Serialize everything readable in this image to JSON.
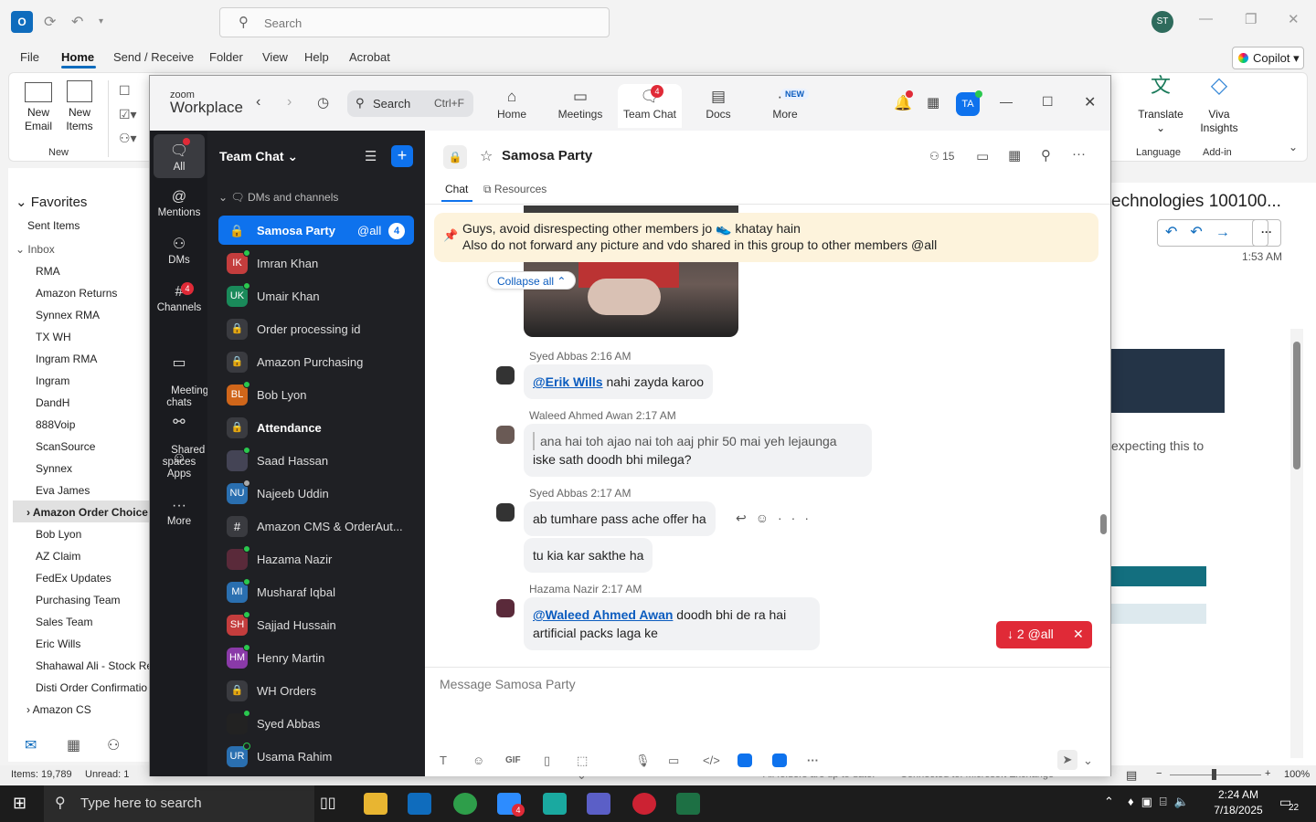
{
  "outlook": {
    "search_placeholder": "Search",
    "avatar": "ST",
    "menu": [
      "File",
      "Home",
      "Send / Receive",
      "Folder",
      "View",
      "Help",
      "Acrobat"
    ],
    "copilot": "Copilot",
    "ribbon": {
      "new_email": "New\nEmail",
      "new_items": "New\nItems",
      "group_new": "New",
      "translate": "Translate",
      "group_language": "Language",
      "viva": "Viva\nInsights",
      "group_addin": "Add-in"
    },
    "favorites": "Favorites",
    "folders": [
      "Sent Items",
      "Inbox",
      "RMA",
      "Amazon Returns",
      "Synnex RMA",
      "TX WH",
      "Ingram RMA",
      "Ingram",
      "DandH",
      "888Voip",
      "ScanSource",
      "Synnex",
      "Eva James",
      "Amazon Order Choice",
      "Bob Lyon",
      "AZ Claim",
      "FedEx Updates",
      "Purchasing Team",
      "Sales Team",
      "Eric Wills",
      "Shahawal Ali - Stock Re",
      "Disti Order Confirmatio",
      "Amazon CS"
    ],
    "reading_title": "echnologies 100100...",
    "reading_time": "1:53 AM",
    "reading_snippet": "expecting this to",
    "status_items": "Items: 19,789",
    "status_unread": "Unread: 1",
    "status_folders": "All folders are up to date.",
    "status_conn": "Connected to: Microsoft Exchange",
    "zoom_level": "100%"
  },
  "taskbar": {
    "search_placeholder": "Type here to search",
    "time": "2:24 AM",
    "date": "7/18/2025",
    "notif_count": "22",
    "zoom_badge": "4"
  },
  "zoom": {
    "brand_top": "zoom",
    "brand_bottom": "Workplace",
    "search": "Search",
    "search_shortcut": "Ctrl+F",
    "tabs": [
      {
        "label": "Home",
        "icon": "home-icon"
      },
      {
        "label": "Meetings",
        "icon": "video-icon"
      },
      {
        "label": "Team Chat",
        "icon": "chat-icon",
        "badge": "4"
      },
      {
        "label": "Docs",
        "icon": "docs-icon"
      },
      {
        "label": "More",
        "icon": "more-icon",
        "badge": "NEW"
      }
    ],
    "user_initials": "TA",
    "rail": [
      {
        "label": "All"
      },
      {
        "label": "Mentions"
      },
      {
        "label": "DMs"
      },
      {
        "label": "Channels",
        "badge": "4"
      },
      {
        "label": "Meeting\nchats"
      },
      {
        "label": "Shared\nspaces"
      },
      {
        "label": "Apps"
      },
      {
        "label": "More"
      }
    ],
    "list_header": "Team Chat",
    "section": "DMs and channels",
    "list": [
      {
        "name": "Samosa Party",
        "type": "lock",
        "tag": "@all",
        "count": "4"
      },
      {
        "name": "Imran Khan",
        "initials": "IK",
        "color": "#c43d3d"
      },
      {
        "name": "Umair Khan",
        "initials": "UK",
        "color": "#1a8a5a"
      },
      {
        "name": "Order processing id",
        "type": "lock"
      },
      {
        "name": "Amazon Purchasing",
        "type": "lock"
      },
      {
        "name": "Bob Lyon",
        "initials": "BL",
        "color": "#d0661a"
      },
      {
        "name": "Attendance",
        "type": "lock"
      },
      {
        "name": "Saad Hassan",
        "initials": "",
        "color": "#445"
      },
      {
        "name": "Najeeb Uddin",
        "initials": "NU",
        "color": "#2a6fb0"
      },
      {
        "name": "Amazon CMS & OrderAut...",
        "type": "hash"
      },
      {
        "name": "Hazama Nazir",
        "initials": "",
        "color": "#5a2a3a"
      },
      {
        "name": "Musharaf Iqbal",
        "initials": "MI",
        "color": "#2a6fb0"
      },
      {
        "name": "Sajjad Hussain",
        "initials": "SH",
        "color": "#c43d3d"
      },
      {
        "name": "Henry Martin",
        "initials": "HM",
        "color": "#8a3aa8"
      },
      {
        "name": "WH Orders",
        "type": "lock"
      },
      {
        "name": "Syed Abbas",
        "initials": "",
        "color": "#222"
      },
      {
        "name": "Usama Rahim",
        "initials": "UR",
        "color": "#2a6fb0"
      }
    ],
    "chat": {
      "title": "Samosa Party",
      "members": "15",
      "tab_chat": "Chat",
      "tab_resources": "Resources",
      "pinned_line1": "Guys, avoid disrespecting other members jo 👟 khatay hain",
      "pinned_line2": "Also do not forward any picture and vdo shared in this group to other members @all",
      "collapse_all": "Collapse all",
      "messages": [
        {
          "author": "Syed Abbas",
          "time": "2:16 AM",
          "mention": "@Erik Wills",
          "text": " nahi zayda karoo"
        },
        {
          "author": "Waleed Ahmed Awan",
          "time": "2:17 AM",
          "quote": "ana hai toh ajao nai toh aaj phir 50 mai yeh lejaunga",
          "text": "iske sath doodh bhi milega?"
        },
        {
          "author": "Syed Abbas",
          "time": "2:17 AM",
          "text": "ab tumhare pass ache offer ha",
          "text2": "tu kia kar sakthe ha"
        },
        {
          "author": "Hazama Nazir",
          "time": "2:17 AM",
          "mention": "@Waleed Ahmed Awan",
          "text": " doodh bhi de ra hai",
          "text2": "artificial packs laga ke"
        }
      ],
      "unread_pill": "2 @all",
      "composer_placeholder": "Message Samosa Party"
    }
  }
}
